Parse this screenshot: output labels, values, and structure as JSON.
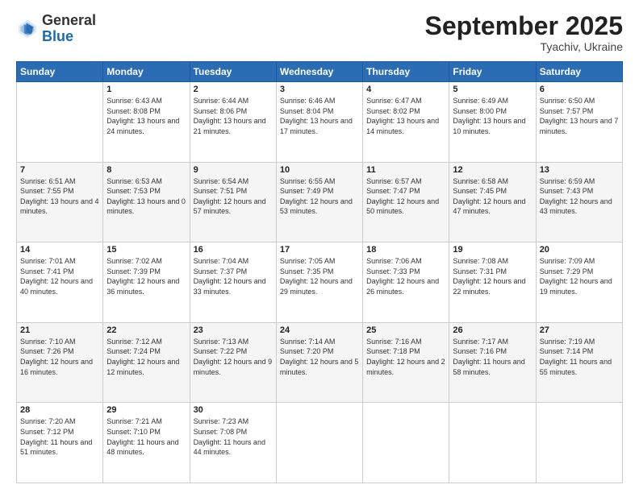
{
  "header": {
    "logo_general": "General",
    "logo_blue": "Blue",
    "month_title": "September 2025",
    "location": "Tyachiv, Ukraine"
  },
  "weekdays": [
    "Sunday",
    "Monday",
    "Tuesday",
    "Wednesday",
    "Thursday",
    "Friday",
    "Saturday"
  ],
  "weeks": [
    [
      {
        "day": "",
        "sunrise": "",
        "sunset": "",
        "daylight": ""
      },
      {
        "day": "1",
        "sunrise": "Sunrise: 6:43 AM",
        "sunset": "Sunset: 8:08 PM",
        "daylight": "Daylight: 13 hours and 24 minutes."
      },
      {
        "day": "2",
        "sunrise": "Sunrise: 6:44 AM",
        "sunset": "Sunset: 8:06 PM",
        "daylight": "Daylight: 13 hours and 21 minutes."
      },
      {
        "day": "3",
        "sunrise": "Sunrise: 6:46 AM",
        "sunset": "Sunset: 8:04 PM",
        "daylight": "Daylight: 13 hours and 17 minutes."
      },
      {
        "day": "4",
        "sunrise": "Sunrise: 6:47 AM",
        "sunset": "Sunset: 8:02 PM",
        "daylight": "Daylight: 13 hours and 14 minutes."
      },
      {
        "day": "5",
        "sunrise": "Sunrise: 6:49 AM",
        "sunset": "Sunset: 8:00 PM",
        "daylight": "Daylight: 13 hours and 10 minutes."
      },
      {
        "day": "6",
        "sunrise": "Sunrise: 6:50 AM",
        "sunset": "Sunset: 7:57 PM",
        "daylight": "Daylight: 13 hours and 7 minutes."
      }
    ],
    [
      {
        "day": "7",
        "sunrise": "Sunrise: 6:51 AM",
        "sunset": "Sunset: 7:55 PM",
        "daylight": "Daylight: 13 hours and 4 minutes."
      },
      {
        "day": "8",
        "sunrise": "Sunrise: 6:53 AM",
        "sunset": "Sunset: 7:53 PM",
        "daylight": "Daylight: 13 hours and 0 minutes."
      },
      {
        "day": "9",
        "sunrise": "Sunrise: 6:54 AM",
        "sunset": "Sunset: 7:51 PM",
        "daylight": "Daylight: 12 hours and 57 minutes."
      },
      {
        "day": "10",
        "sunrise": "Sunrise: 6:55 AM",
        "sunset": "Sunset: 7:49 PM",
        "daylight": "Daylight: 12 hours and 53 minutes."
      },
      {
        "day": "11",
        "sunrise": "Sunrise: 6:57 AM",
        "sunset": "Sunset: 7:47 PM",
        "daylight": "Daylight: 12 hours and 50 minutes."
      },
      {
        "day": "12",
        "sunrise": "Sunrise: 6:58 AM",
        "sunset": "Sunset: 7:45 PM",
        "daylight": "Daylight: 12 hours and 47 minutes."
      },
      {
        "day": "13",
        "sunrise": "Sunrise: 6:59 AM",
        "sunset": "Sunset: 7:43 PM",
        "daylight": "Daylight: 12 hours and 43 minutes."
      }
    ],
    [
      {
        "day": "14",
        "sunrise": "Sunrise: 7:01 AM",
        "sunset": "Sunset: 7:41 PM",
        "daylight": "Daylight: 12 hours and 40 minutes."
      },
      {
        "day": "15",
        "sunrise": "Sunrise: 7:02 AM",
        "sunset": "Sunset: 7:39 PM",
        "daylight": "Daylight: 12 hours and 36 minutes."
      },
      {
        "day": "16",
        "sunrise": "Sunrise: 7:04 AM",
        "sunset": "Sunset: 7:37 PM",
        "daylight": "Daylight: 12 hours and 33 minutes."
      },
      {
        "day": "17",
        "sunrise": "Sunrise: 7:05 AM",
        "sunset": "Sunset: 7:35 PM",
        "daylight": "Daylight: 12 hours and 29 minutes."
      },
      {
        "day": "18",
        "sunrise": "Sunrise: 7:06 AM",
        "sunset": "Sunset: 7:33 PM",
        "daylight": "Daylight: 12 hours and 26 minutes."
      },
      {
        "day": "19",
        "sunrise": "Sunrise: 7:08 AM",
        "sunset": "Sunset: 7:31 PM",
        "daylight": "Daylight: 12 hours and 22 minutes."
      },
      {
        "day": "20",
        "sunrise": "Sunrise: 7:09 AM",
        "sunset": "Sunset: 7:29 PM",
        "daylight": "Daylight: 12 hours and 19 minutes."
      }
    ],
    [
      {
        "day": "21",
        "sunrise": "Sunrise: 7:10 AM",
        "sunset": "Sunset: 7:26 PM",
        "daylight": "Daylight: 12 hours and 16 minutes."
      },
      {
        "day": "22",
        "sunrise": "Sunrise: 7:12 AM",
        "sunset": "Sunset: 7:24 PM",
        "daylight": "Daylight: 12 hours and 12 minutes."
      },
      {
        "day": "23",
        "sunrise": "Sunrise: 7:13 AM",
        "sunset": "Sunset: 7:22 PM",
        "daylight": "Daylight: 12 hours and 9 minutes."
      },
      {
        "day": "24",
        "sunrise": "Sunrise: 7:14 AM",
        "sunset": "Sunset: 7:20 PM",
        "daylight": "Daylight: 12 hours and 5 minutes."
      },
      {
        "day": "25",
        "sunrise": "Sunrise: 7:16 AM",
        "sunset": "Sunset: 7:18 PM",
        "daylight": "Daylight: 12 hours and 2 minutes."
      },
      {
        "day": "26",
        "sunrise": "Sunrise: 7:17 AM",
        "sunset": "Sunset: 7:16 PM",
        "daylight": "Daylight: 11 hours and 58 minutes."
      },
      {
        "day": "27",
        "sunrise": "Sunrise: 7:19 AM",
        "sunset": "Sunset: 7:14 PM",
        "daylight": "Daylight: 11 hours and 55 minutes."
      }
    ],
    [
      {
        "day": "28",
        "sunrise": "Sunrise: 7:20 AM",
        "sunset": "Sunset: 7:12 PM",
        "daylight": "Daylight: 11 hours and 51 minutes."
      },
      {
        "day": "29",
        "sunrise": "Sunrise: 7:21 AM",
        "sunset": "Sunset: 7:10 PM",
        "daylight": "Daylight: 11 hours and 48 minutes."
      },
      {
        "day": "30",
        "sunrise": "Sunrise: 7:23 AM",
        "sunset": "Sunset: 7:08 PM",
        "daylight": "Daylight: 11 hours and 44 minutes."
      },
      {
        "day": "",
        "sunrise": "",
        "sunset": "",
        "daylight": ""
      },
      {
        "day": "",
        "sunrise": "",
        "sunset": "",
        "daylight": ""
      },
      {
        "day": "",
        "sunrise": "",
        "sunset": "",
        "daylight": ""
      },
      {
        "day": "",
        "sunrise": "",
        "sunset": "",
        "daylight": ""
      }
    ]
  ]
}
